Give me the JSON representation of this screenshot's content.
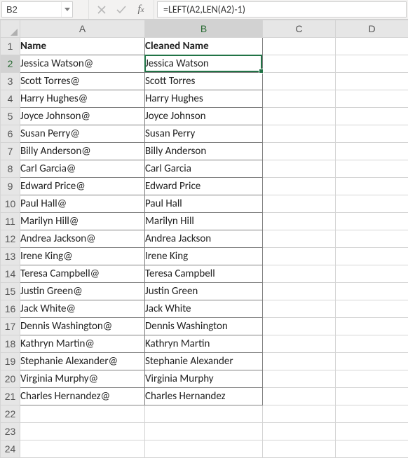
{
  "formula_bar": {
    "name_box_value": "B2",
    "formula_value": "=LEFT(A2,LEN(A2)-1)"
  },
  "columns": [
    "A",
    "B",
    "C",
    "D"
  ],
  "header_row": {
    "A": "Name",
    "B": "Cleaned Name"
  },
  "data_rows": [
    {
      "A": "Jessica Watson@",
      "B": "Jessica Watson"
    },
    {
      "A": "Scott Torres@",
      "B": "Scott Torres"
    },
    {
      "A": "Harry Hughes@",
      "B": "Harry Hughes"
    },
    {
      "A": "Joyce Johnson@",
      "B": "Joyce Johnson"
    },
    {
      "A": "Susan Perry@",
      "B": "Susan Perry"
    },
    {
      "A": "Billy Anderson@",
      "B": "Billy Anderson"
    },
    {
      "A": "Carl Garcia@",
      "B": "Carl Garcia"
    },
    {
      "A": "Edward Price@",
      "B": "Edward Price"
    },
    {
      "A": "Paul Hall@",
      "B": "Paul Hall"
    },
    {
      "A": "Marilyn Hill@",
      "B": "Marilyn Hill"
    },
    {
      "A": "Andrea Jackson@",
      "B": "Andrea Jackson"
    },
    {
      "A": "Irene King@",
      "B": "Irene King"
    },
    {
      "A": "Teresa Campbell@",
      "B": "Teresa Campbell"
    },
    {
      "A": "Justin Green@",
      "B": "Justin Green"
    },
    {
      "A": "Jack White@",
      "B": "Jack White"
    },
    {
      "A": "Dennis Washington@",
      "B": "Dennis Washington"
    },
    {
      "A": "Kathryn Martin@",
      "B": "Kathryn Martin"
    },
    {
      "A": "Stephanie Alexander@",
      "B": "Stephanie Alexander"
    },
    {
      "A": "Virginia Murphy@",
      "B": "Virginia Murphy"
    },
    {
      "A": "Charles Hernandez@",
      "B": "Charles Hernandez"
    }
  ],
  "empty_rows": [
    22,
    23,
    24
  ],
  "active_cell": "B2"
}
